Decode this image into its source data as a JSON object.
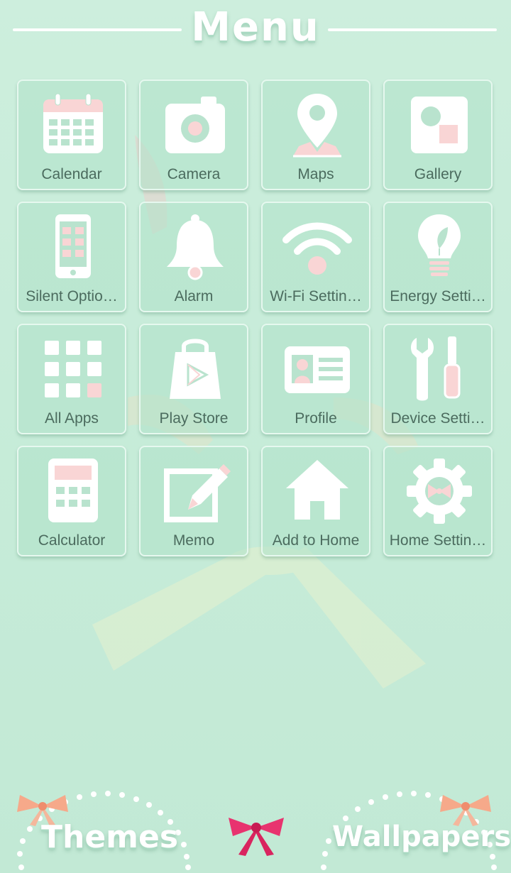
{
  "header": {
    "title": "Menu"
  },
  "tiles": [
    {
      "label": "Calendar",
      "icon": "calendar-icon"
    },
    {
      "label": "Camera",
      "icon": "camera-icon"
    },
    {
      "label": "Maps",
      "icon": "map-pin-icon"
    },
    {
      "label": "Gallery",
      "icon": "gallery-icon"
    },
    {
      "label": "Silent Optio…",
      "icon": "phone-icon"
    },
    {
      "label": "Alarm",
      "icon": "bell-icon"
    },
    {
      "label": "Wi-Fi Settin…",
      "icon": "wifi-icon"
    },
    {
      "label": "Energy Setti…",
      "icon": "lightbulb-icon"
    },
    {
      "label": "All Apps",
      "icon": "app-grid-icon"
    },
    {
      "label": "Play Store",
      "icon": "shopping-bag-icon"
    },
    {
      "label": "Profile",
      "icon": "id-card-icon"
    },
    {
      "label": "Device Setti…",
      "icon": "tools-icon"
    },
    {
      "label": "Calculator",
      "icon": "calculator-icon"
    },
    {
      "label": "Memo",
      "icon": "memo-pencil-icon"
    },
    {
      "label": "Add to Home",
      "icon": "house-icon"
    },
    {
      "label": "Home Settin…",
      "icon": "gear-bow-icon"
    }
  ],
  "footer": {
    "themes_label": "Themes",
    "wallpapers_label": "Wallpapers"
  },
  "colors": {
    "background": "#c7ecd9",
    "icon_white": "#ffffff",
    "accent_pink": "#f9d5d5",
    "bow_pink": "#e8336f",
    "label_text": "#4b6b5e"
  }
}
